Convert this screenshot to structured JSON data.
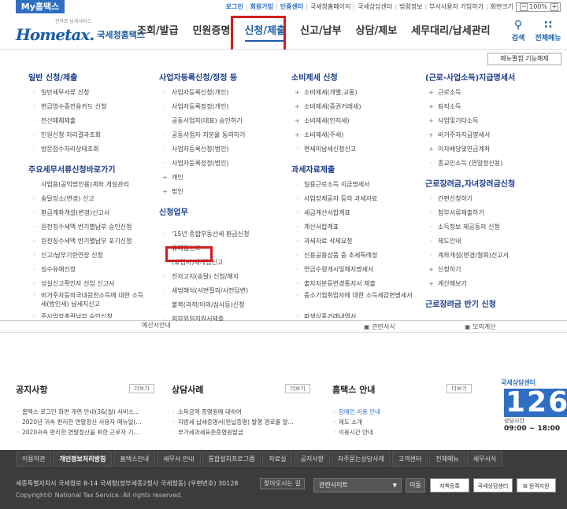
{
  "topbar": {
    "my_tab": "My홈택스",
    "links": [
      "로그인",
      "회원가입",
      "인증센터",
      "국세청홈페이지",
      "국세상담센터",
      "법령정보",
      "부서사용자 가입하기"
    ],
    "zoom_label": "화면크기",
    "zoom_value": "100%"
  },
  "header": {
    "logo_main": "Hometax.",
    "logo_sub": "국세청홈택스",
    "logo_tag": "전자로 납세서비스",
    "nav": [
      "조회/발급",
      "민원증명",
      "신청/제출",
      "신고/납부",
      "상담/제보",
      "세무대리/납세관리"
    ],
    "search_label": "검색",
    "allmenu_label": "전체메뉴"
  },
  "menu": {
    "func_button": "메뉴펼침 기능해제",
    "col1": {
      "h1": "일반 신청/제출",
      "items1": [
        "일반세무서류 신청",
        "현금영수증전용카드 신청",
        "전산매체제출",
        "민원신청 처리결과조회",
        "방문접수처리상태조회"
      ],
      "h2": "주요세무서류신청바로가기",
      "items2": [
        "사업용(공익법인용)계좌 개설관리",
        "송달장소(변경) 신고",
        "환급계좌개설(변경)신고서",
        "원천징수세액 반기별납부 승인신청",
        "원천징수세액 반기별납부 포기신청",
        "신고/납부기한연장 신청",
        "징수유예신청",
        "성실신고확인자 선임 신고서",
        "비거주자등의국내원천소득에 대한 소득세(법인세) 납세지신고"
      ],
      "cut": "주사업장총괄납부 승인신청"
    },
    "col2": {
      "h1": "사업자등록신청/정정 등",
      "items1": [
        "사업자등록신청(개인)",
        "사업자등록정정(개인)",
        "공동사업자(대표) 승인하기",
        "공동사업자 지분율 동의하기",
        "사업자등록신청(법인)",
        "사업자등록정정(법인)"
      ],
      "plus1": [
        "개인",
        "법인"
      ],
      "h2": "신청업무",
      "items2": [
        "'15년 종합부동산세 환급신청",
        "휴폐업신고",
        "(휴업자)재개업신고",
        "전자고지(송달) 신청/해지",
        "세법해석(서면질의/사전답변)",
        "불복(과적/이의/심사등)신청",
        "외부위원지원서제출"
      ]
    },
    "col3": {
      "h1": "소비제세 신청",
      "plus1": [
        "소비제세(개별,교통)",
        "소비제세(증권거래세)",
        "소비제세(인지세)",
        "소비제세(주세)"
      ],
      "items1": [
        "면세미납세신청신고"
      ],
      "h2": "과세자료제출",
      "items2": [
        "일용근로소득 지급명세서",
        "사업장제공자 등의 과세자료",
        "세금계산서합계표",
        "계산서합계표",
        "과세자료 삭제요청",
        "신용공용상품 중 조세특례정",
        "연금수령개시및해지명세서",
        "출자지분등변경통지서 제출",
        "중소기업취업자에 대한 소득세감면명세서"
      ],
      "cut": "파생상품거래내역서"
    },
    "col4": {
      "h1": "(근로·사업소득)지급명세서",
      "plus1": [
        "근로소득",
        "퇴직소득",
        "사업및기타소득",
        "비거주자지급명세서",
        "이자배당및연금계좌"
      ],
      "items1": [
        "종교인소득 (연말정산용)"
      ],
      "h2": "근로장려금,자녀장려금신청",
      "items2": [
        "간편신청하기",
        "첨부서류제출하기",
        "소득정보 제공동의 신청",
        "제도안내",
        "계좌개설(변경/철회)신고서"
      ],
      "plus2": [
        "신청하기",
        "계산해보기"
      ],
      "h3": "근로장려금 반기 신청"
    }
  },
  "lower": {
    "fake1": "예산서안내",
    "fake2": "관련서식",
    "fake3": "모의계산",
    "notice_title": "공지사항",
    "notice_more": "더보기",
    "notice_items": [
      "홈택스 로그인 화면 개편 안내(3&(월) 서비스...",
      "2020년 귀속 편리한 연말정산 사용자 매뉴얼(...",
      "2020귀속 편리한 연말정산을 위한 근로자 기..."
    ],
    "case_title": "상담사례",
    "case_more": "더보기",
    "case_items": [
      "소득금액 증명원에 대하여",
      "지방세 납세증명서(완납증명) 발행 경로를 알...",
      "부가세과세표준증명원발급"
    ],
    "guide_title": "홈택스 안내",
    "guide_more": "더보기",
    "guide_items": [
      "장애인 이용 안내",
      "제도 소개",
      "이용시간 안내"
    ],
    "cc_title": "국세상담센터",
    "cc_number": "126",
    "cc_hours_label": "상담시간",
    "cc_hours": "09:00 ~ 18:00"
  },
  "footer": {
    "nav": [
      "이용약관",
      "개인정보처리방침",
      "홈택스안내",
      "세무서 안내",
      "통합설치프로그램",
      "자료실",
      "공지사항",
      "자주묻는상담사례",
      "고객센터",
      "전체메뉴",
      "세무서식"
    ],
    "address": "세종특별자치시 국세청로 8-14 국세청(정부세종2청사 국세청동) (우편번호) 30128",
    "find_way": "찾아오시는 길",
    "related": "관련사이트",
    "go": "이동",
    "copyright": "Copyright© National Tax Service. All rights reserved.",
    "badge1": "지책등록",
    "badge2": "국세상담센터",
    "badge3": "원격지원"
  },
  "colors": {
    "brand": "#1b5ea6",
    "highlight": "#d31d1d",
    "footer": "#3c3c3c"
  }
}
